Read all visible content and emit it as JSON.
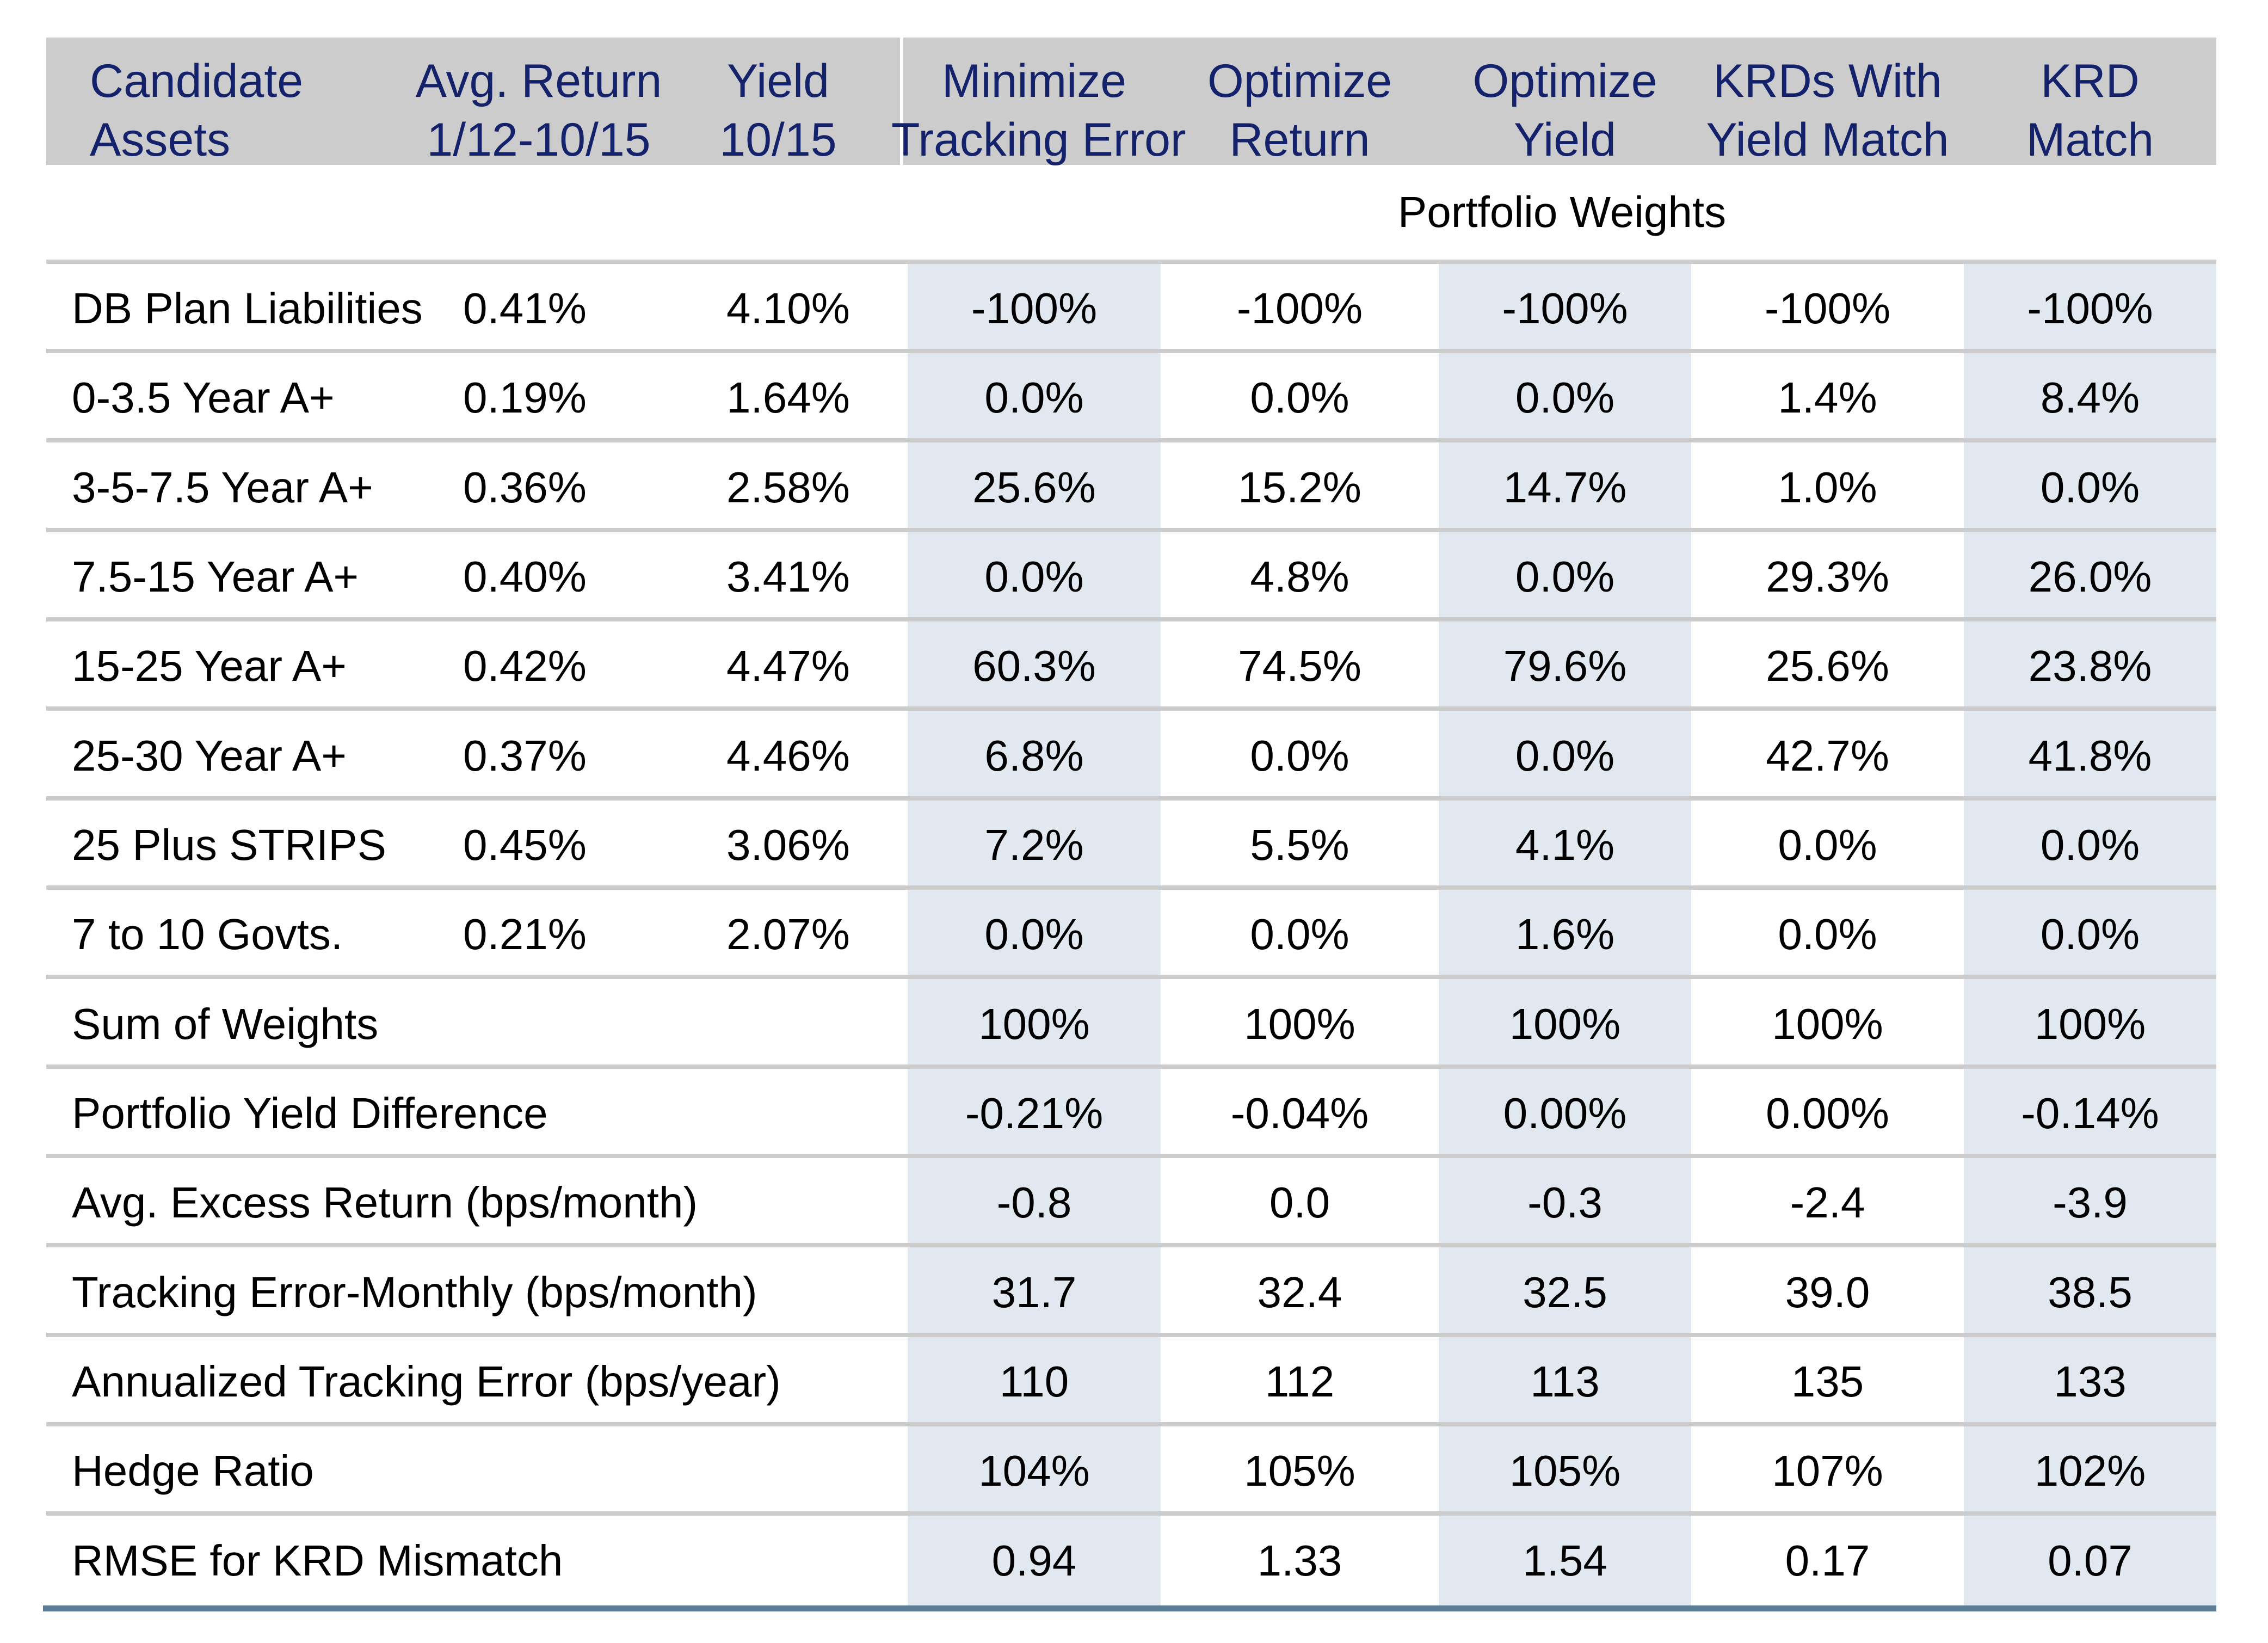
{
  "colors": {
    "header_bg": "#cccccc",
    "header_text": "#14216b",
    "shaded_column": "#e2e8ef",
    "row_rule": "#cccccc",
    "bottom_rule": "#5b7e96"
  },
  "header": {
    "candidate_assets": [
      "Candidate",
      "Assets"
    ],
    "avg_return": [
      "Avg. Return",
      "1/12-10/15"
    ],
    "yield": [
      "Yield",
      "10/15"
    ],
    "strategies": [
      [
        "Minimize",
        "Tracking Error"
      ],
      [
        "Optimize",
        "Return"
      ],
      [
        "Optimize",
        "Yield"
      ],
      [
        "KRDs With",
        "Yield Match"
      ],
      [
        "KRD",
        "Match"
      ]
    ]
  },
  "subheader": "Portfolio Weights",
  "rows": [
    {
      "label": "DB Plan Liabilities",
      "avg_return": "0.41%",
      "yield": "4.10%",
      "values": [
        "-100%",
        "-100%",
        "-100%",
        "-100%",
        "-100%"
      ]
    },
    {
      "label": "0-3.5 Year A+",
      "avg_return": "0.19%",
      "yield": "1.64%",
      "values": [
        "0.0%",
        "0.0%",
        "0.0%",
        "1.4%",
        "8.4%"
      ]
    },
    {
      "label": "3-5-7.5 Year A+",
      "avg_return": "0.36%",
      "yield": "2.58%",
      "values": [
        "25.6%",
        "15.2%",
        "14.7%",
        "1.0%",
        "0.0%"
      ]
    },
    {
      "label": "7.5-15 Year A+",
      "avg_return": "0.40%",
      "yield": "3.41%",
      "values": [
        "0.0%",
        "4.8%",
        "0.0%",
        "29.3%",
        "26.0%"
      ]
    },
    {
      "label": "15-25 Year A+",
      "avg_return": "0.42%",
      "yield": "4.47%",
      "values": [
        "60.3%",
        "74.5%",
        "79.6%",
        "25.6%",
        "23.8%"
      ]
    },
    {
      "label": "25-30 Year A+",
      "avg_return": "0.37%",
      "yield": "4.46%",
      "values": [
        "6.8%",
        "0.0%",
        "0.0%",
        "42.7%",
        "41.8%"
      ]
    },
    {
      "label": "25 Plus STRIPS",
      "avg_return": "0.45%",
      "yield": "3.06%",
      "values": [
        "7.2%",
        "5.5%",
        "4.1%",
        "0.0%",
        "0.0%"
      ]
    },
    {
      "label": "7 to 10 Govts.",
      "avg_return": "0.21%",
      "yield": "2.07%",
      "values": [
        "0.0%",
        "0.0%",
        "1.6%",
        "0.0%",
        "0.0%"
      ]
    },
    {
      "label": "Sum of Weights",
      "avg_return": "",
      "yield": "",
      "values": [
        "100%",
        "100%",
        "100%",
        "100%",
        "100%"
      ]
    },
    {
      "label": "Portfolio Yield Difference",
      "avg_return": "",
      "yield": "",
      "values": [
        "-0.21%",
        "-0.04%",
        "0.00%",
        "0.00%",
        "-0.14%"
      ]
    },
    {
      "label": "Avg. Excess Return (bps/month)",
      "avg_return": "",
      "yield": "",
      "values": [
        "-0.8",
        "0.0",
        "-0.3",
        "-2.4",
        "-3.9"
      ]
    },
    {
      "label": "Tracking Error-Monthly (bps/month)",
      "avg_return": "",
      "yield": "",
      "values": [
        "31.7",
        "32.4",
        "32.5",
        "39.0",
        "38.5"
      ]
    },
    {
      "label": "Annualized Tracking Error (bps/year)",
      "avg_return": "",
      "yield": "",
      "values": [
        "110",
        "112",
        "113",
        "135",
        "133"
      ]
    },
    {
      "label": "Hedge Ratio",
      "avg_return": "",
      "yield": "",
      "values": [
        "104%",
        "105%",
        "105%",
        "107%",
        "102%"
      ]
    },
    {
      "label": "RMSE for KRD Mismatch",
      "avg_return": "",
      "yield": "",
      "values": [
        "0.94",
        "1.33",
        "1.54",
        "0.17",
        "0.07"
      ]
    }
  ]
}
